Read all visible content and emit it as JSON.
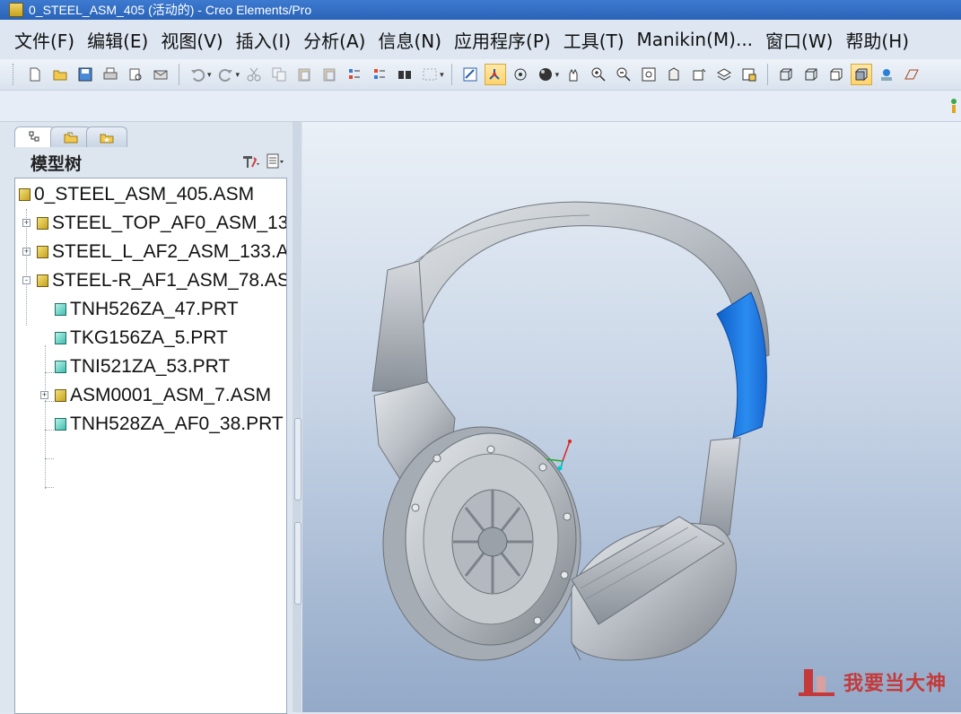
{
  "window": {
    "title": "0_STEEL_ASM_405 (活动的) - Creo Elements/Pro"
  },
  "menu": [
    {
      "label": "文件(F)"
    },
    {
      "label": "编辑(E)"
    },
    {
      "label": "视图(V)"
    },
    {
      "label": "插入(I)"
    },
    {
      "label": "分析(A)"
    },
    {
      "label": "信息(N)"
    },
    {
      "label": "应用程序(P)"
    },
    {
      "label": "工具(T)"
    },
    {
      "label": "Manikin(M)..."
    },
    {
      "label": "窗口(W)"
    },
    {
      "label": "帮助(H)"
    }
  ],
  "toolbar": {
    "icons": [
      "new-file-icon",
      "open-folder-icon",
      "save-icon",
      "print-icon",
      "print-preview-icon",
      "mail-icon",
      "undo-icon",
      "redo-icon",
      "cut-icon",
      "copy-icon",
      "paste-icon",
      "paste-special-icon",
      "regenerate-icon",
      "regenerate-manager-icon",
      "find-icon",
      "select-box-icon",
      "repaint-icon",
      "spin-center-icon",
      "orient-mode-icon",
      "appearance-sphere-icon",
      "pan-hand-icon",
      "zoom-in-icon",
      "zoom-out-icon",
      "refit-icon",
      "reorient-icon",
      "saved-views-icon",
      "layers-icon",
      "view-manager-icon",
      "wireframe-icon",
      "hidden-line-icon",
      "no-hidden-icon",
      "shading-icon",
      "enhanced-realism-icon"
    ],
    "accent_active": "#ffd36a"
  },
  "model_tree": {
    "tabs": [
      "model-tree-tab",
      "folder-browser-tab",
      "favorites-tab"
    ],
    "title": "模型树",
    "nodes": [
      {
        "label": "0_STEEL_ASM_405.ASM",
        "type": "asm",
        "level": 0,
        "expander": ""
      },
      {
        "label": "STEEL_TOP_AF0_ASM_13",
        "type": "asm",
        "level": 1,
        "expander": "+"
      },
      {
        "label": "STEEL_L_AF2_ASM_133.A",
        "type": "asm",
        "level": 1,
        "expander": "+"
      },
      {
        "label": "STEEL-R_AF1_ASM_78.AS",
        "type": "asm",
        "level": 1,
        "expander": "-"
      },
      {
        "label": "TNH526ZA_47.PRT",
        "type": "prt",
        "level": 2,
        "expander": ""
      },
      {
        "label": "TKG156ZA_5.PRT",
        "type": "prt",
        "level": 2,
        "expander": ""
      },
      {
        "label": "TNI521ZA_53.PRT",
        "type": "prt",
        "level": 2,
        "expander": ""
      },
      {
        "label": "ASM0001_ASM_7.ASM",
        "type": "asm",
        "level": 2,
        "expander": "+"
      },
      {
        "label": "TNH528ZA_AF0_38.PRT",
        "type": "prt",
        "level": 2,
        "expander": ""
      }
    ]
  },
  "viewport": {
    "model_color": "#c2c7cc",
    "highlight_color": "#1a7fe8",
    "watermark": "我要当大神"
  }
}
